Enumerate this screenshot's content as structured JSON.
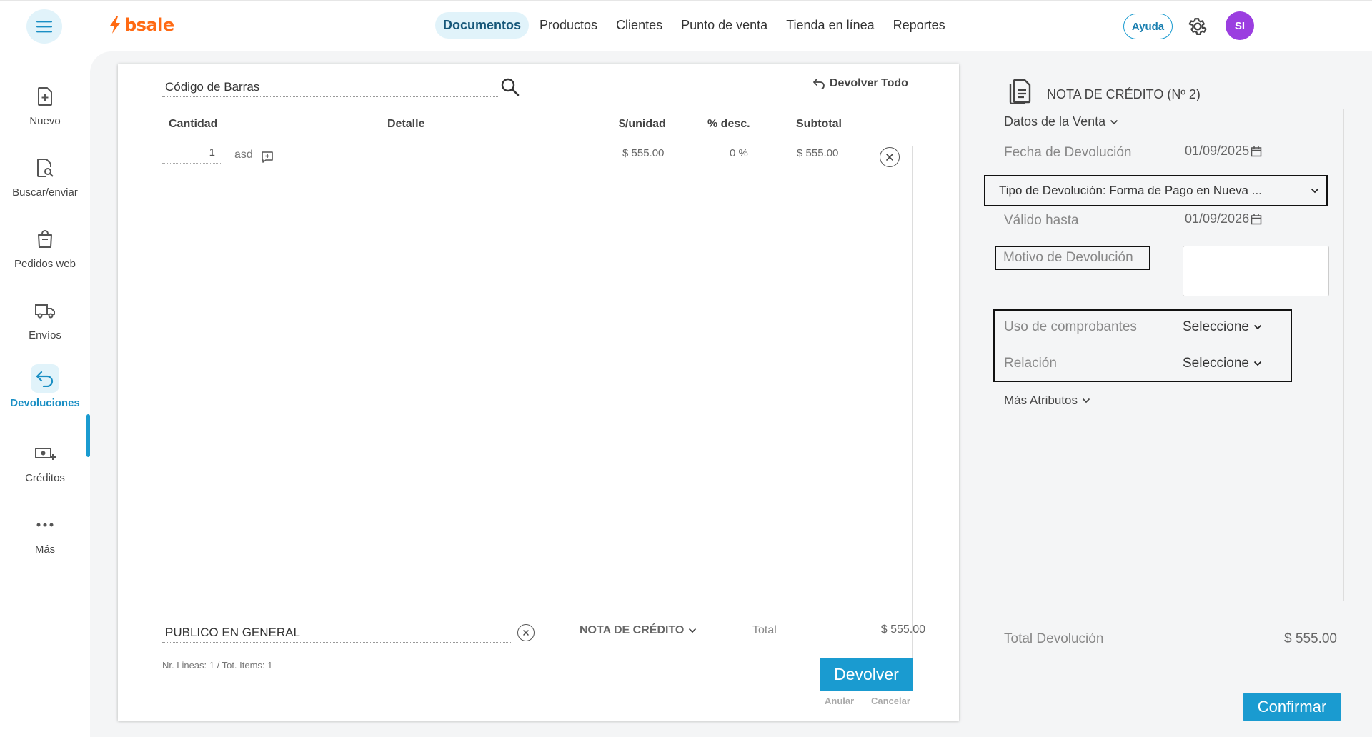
{
  "header": {
    "logo_text": "bsale",
    "nav": [
      {
        "label": "Documentos",
        "active": true
      },
      {
        "label": "Productos"
      },
      {
        "label": "Clientes"
      },
      {
        "label": "Punto de venta"
      },
      {
        "label": "Tienda en línea"
      },
      {
        "label": "Reportes"
      }
    ],
    "help_label": "Ayuda",
    "avatar_initials": "SI",
    "accent_color": "#1a9bd0",
    "brand_color": "#ff6a13"
  },
  "sidebar": {
    "items": [
      {
        "label": "Nuevo",
        "icon": "file-plus-icon"
      },
      {
        "label": "Buscar/enviar",
        "icon": "file-search-icon"
      },
      {
        "label": "Pedidos web",
        "icon": "shopping-bag-icon"
      },
      {
        "label": "Envíos",
        "icon": "truck-icon"
      },
      {
        "label": "Devoluciones",
        "icon": "return-arrow-icon",
        "active": true
      },
      {
        "label": "Créditos",
        "icon": "money-plus-icon"
      },
      {
        "label": "Más",
        "icon": "more-dots-icon"
      }
    ]
  },
  "document": {
    "barcode_placeholder": "Código de Barras",
    "return_all_label": "Devolver Todo",
    "columns": {
      "qty": "Cantidad",
      "detail": "Detalle",
      "unit_price": "$/unidad",
      "discount": "% desc.",
      "subtotal": "Subtotal"
    },
    "rows": [
      {
        "qty": "1",
        "detail": "asd",
        "unit_price": "$ 555.00",
        "discount": "0 %",
        "subtotal": "$ 555.00"
      }
    ],
    "client": "PUBLICO EN GENERAL",
    "doc_type": "NOTA DE CRÉDITO",
    "total_label": "Total",
    "total_value": "$ 555.00",
    "summary": "Nr. Lineas: 1 / Tot. Items: 1",
    "submit_label": "Devolver",
    "void_label": "Anular",
    "cancel_label": "Cancelar"
  },
  "credit_note": {
    "title": "NOTA DE CRÉDITO (Nº 2)",
    "sale_data_label": "Datos de la Venta",
    "return_date_label": "Fecha de Devolución",
    "return_date": "01/09/2025",
    "return_type": "Tipo de Devolución: Forma de Pago en Nueva ...",
    "valid_until_label": "Válido hasta",
    "valid_until": "01/09/2026",
    "reason_label": "Motivo de Devolución",
    "usage_label": "Uso de comprobantes",
    "usage_value": "Seleccione",
    "relation_label": "Relación",
    "relation_value": "Seleccione",
    "more_attributes_label": "Más Atributos",
    "total_label": "Total Devolución",
    "total_value": "$ 555.00",
    "confirm_label": "Confirmar"
  }
}
